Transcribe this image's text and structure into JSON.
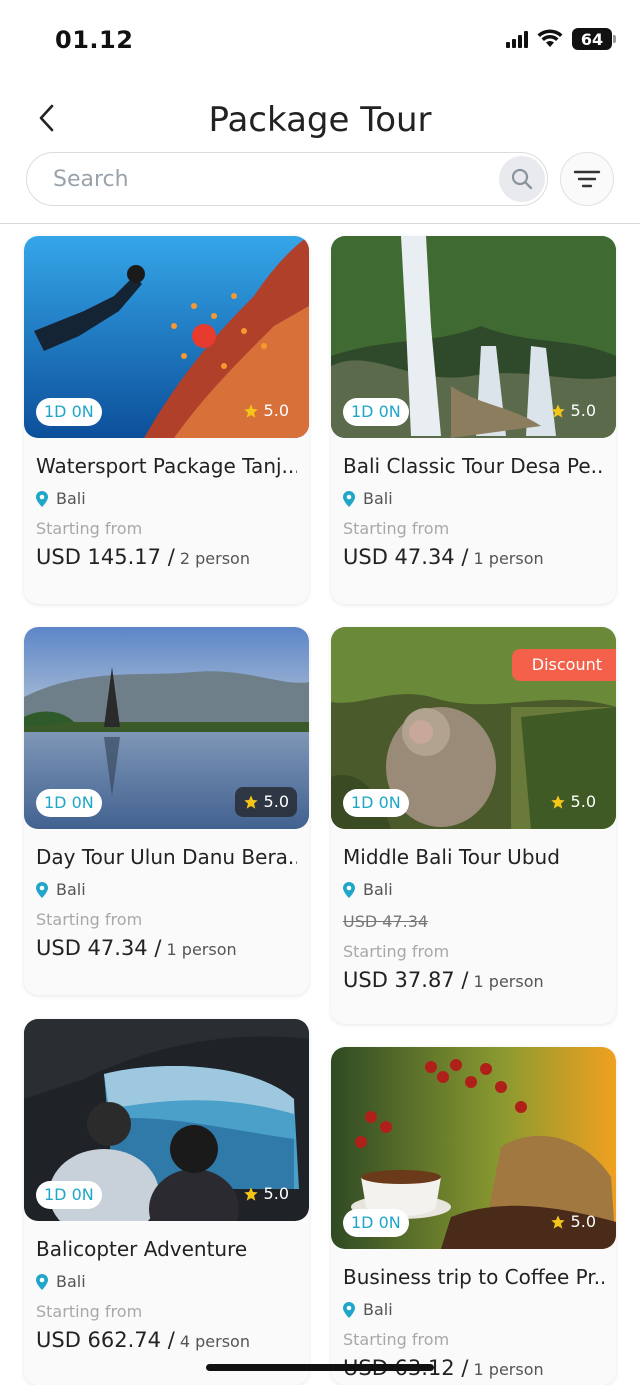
{
  "status_bar": {
    "time": "01.12",
    "battery": "64"
  },
  "header": {
    "title": "Package Tour"
  },
  "search": {
    "placeholder": "Search"
  },
  "colors": {
    "accent": "#1fa6c8",
    "discount": "#f4604a",
    "star": "#f5c518"
  },
  "tours": [
    {
      "title": "Watersport Package Tanj...",
      "duration": "1D 0N",
      "rating": "5.0",
      "location": "Bali",
      "starting_label": "Starting from",
      "price": "USD 145.17 /",
      "per": "2 person",
      "image": "underwater-diving-photo"
    },
    {
      "title": "Bali Classic Tour Desa Pe...",
      "duration": "1D 0N",
      "rating": "5.0",
      "location": "Bali",
      "starting_label": "Starting from",
      "price": "USD 47.34 /",
      "per": "1 person",
      "image": "waterfall-photo"
    },
    {
      "title": "Day Tour Ulun Danu Bera...",
      "duration": "1D 0N",
      "rating": "5.0",
      "location": "Bali",
      "starting_label": "Starting from",
      "price": "USD 47.34 /",
      "per": "1 person",
      "image": "lake-temple-photo"
    },
    {
      "title": "Middle Bali Tour Ubud",
      "duration": "1D 0N",
      "rating": "5.0",
      "location": "Bali",
      "discount": "Discount",
      "old_price": "USD 47.34",
      "starting_label": "Starting from",
      "price": "USD 37.87 /",
      "per": "1 person",
      "image": "monkey-forest-photo"
    },
    {
      "title": "Balicopter Adventure",
      "duration": "1D 0N",
      "rating": "5.0",
      "location": "Bali",
      "starting_label": "Starting from",
      "price": "USD 662.74 /",
      "per": "4 person",
      "image": "helicopter-cockpit-photo"
    },
    {
      "title": "Business trip to Coffee Pr...",
      "duration": "1D 0N",
      "rating": "5.0",
      "location": "Bali",
      "starting_label": "Starting from",
      "price": "USD 63.12 /",
      "per": "1 person",
      "image": "coffee-beans-photo"
    }
  ]
}
